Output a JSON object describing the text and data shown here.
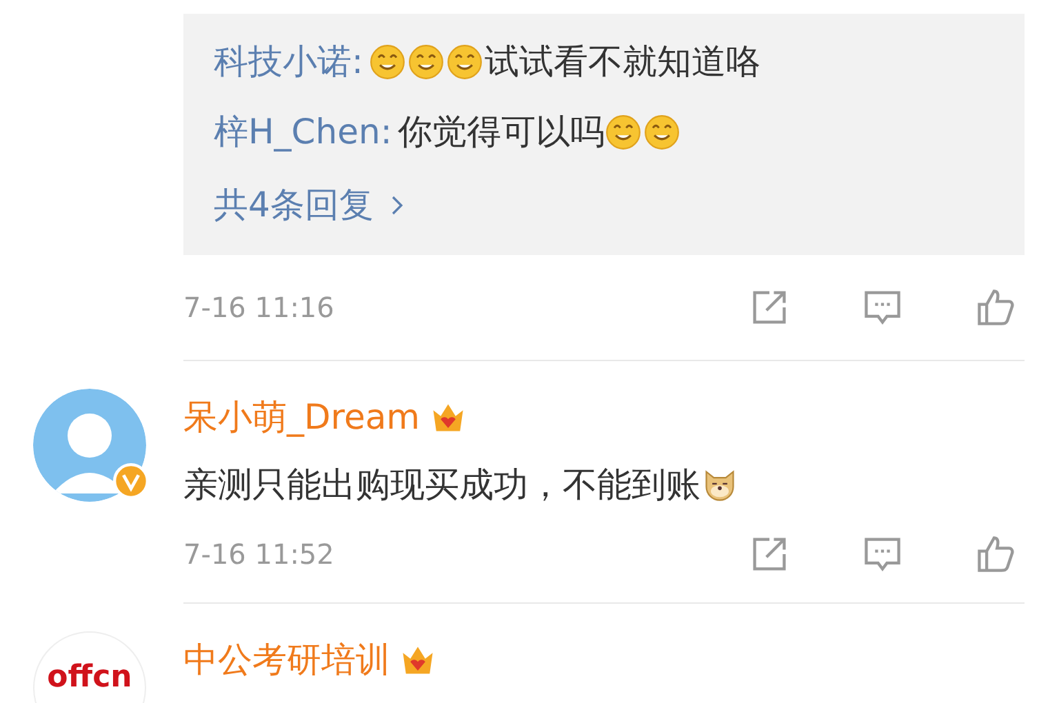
{
  "comments": [
    {
      "kind": "replies-tail",
      "replies": [
        {
          "author": "科技小诺:",
          "parts": [
            {
              "kind": "emoji"
            },
            {
              "kind": "emoji"
            },
            {
              "kind": "emoji"
            },
            {
              "kind": "text",
              "text": "试试看不就知道咯"
            }
          ]
        },
        {
          "author": "梓H_Chen:",
          "parts": [
            {
              "kind": "text",
              "text": "你觉得可以吗"
            },
            {
              "kind": "emoji"
            },
            {
              "kind": "emoji"
            }
          ]
        }
      ],
      "more": "共4条回复",
      "time": "7-16 11:16"
    },
    {
      "kind": "comment",
      "avatar": {
        "kind": "person"
      },
      "verified": true,
      "name": "呆小萌_Dream",
      "parts": [
        {
          "kind": "text",
          "text": "亲测只能出购现买成功，不能到账"
        },
        {
          "kind": "dog"
        }
      ],
      "time": "7-16 11:52"
    },
    {
      "kind": "comment",
      "avatar": {
        "kind": "logo",
        "text": "offcn"
      },
      "verified": false,
      "name": "中公考研培训"
    }
  ]
}
